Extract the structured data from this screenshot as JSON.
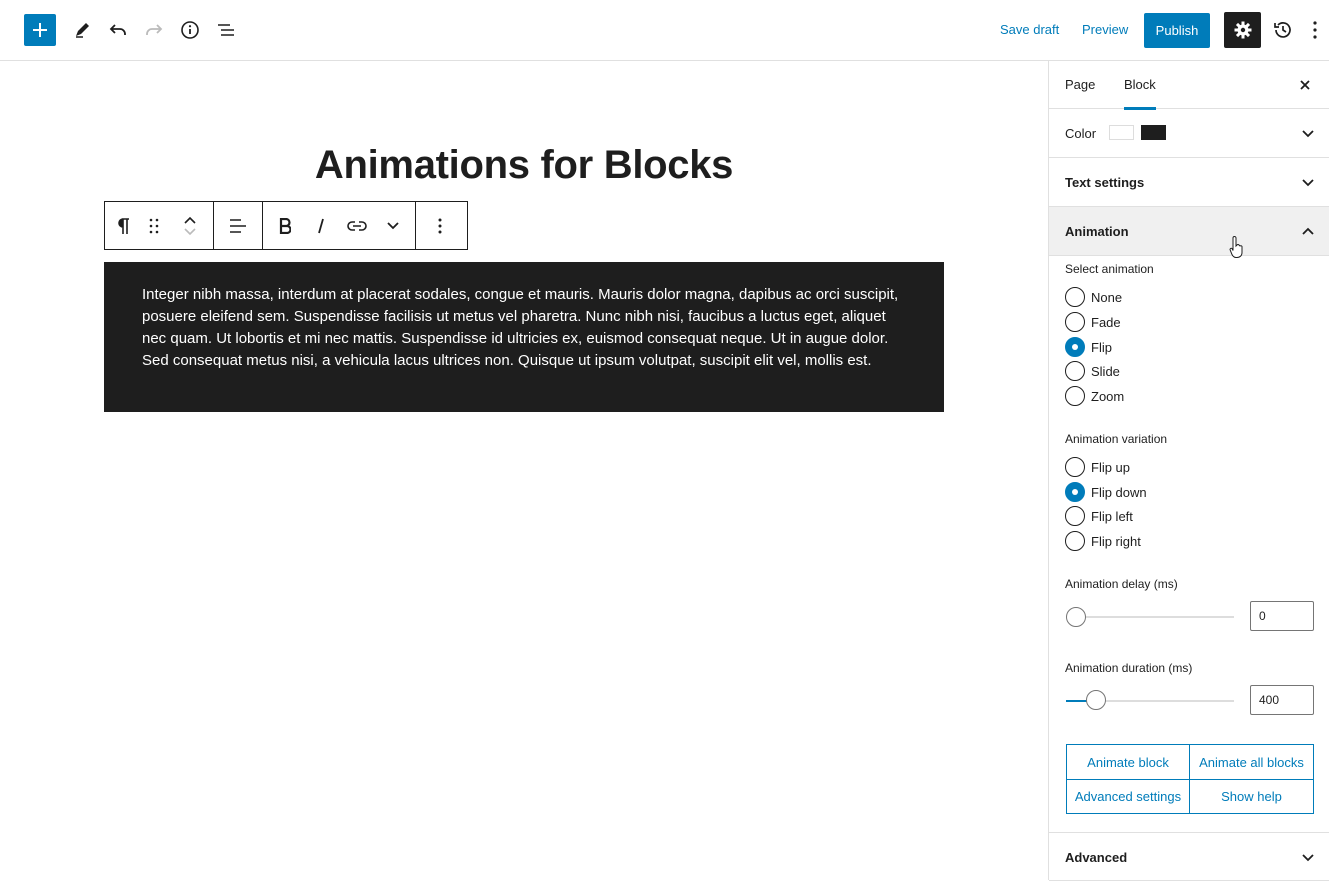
{
  "topbar": {
    "save_draft": "Save draft",
    "preview": "Preview",
    "publish": "Publish"
  },
  "editor": {
    "title": "Animations for Blocks",
    "paragraph": "Integer nibh massa, interdum at placerat sodales, congue et mauris. Mauris dolor magna, dapibus ac orci suscipit, posuere eleifend sem. Suspendisse facilisis ut metus vel pharetra. Nunc nibh nisi, faucibus a luctus eget, aliquet nec quam. Ut lobortis et mi nec mattis. Suspendisse id ultricies ex, euismod consequat neque. Ut in augue dolor. Sed consequat metus nisi, a vehicula lacus ultrices non. Quisque ut ipsum volutpat, suscipit elit vel, mollis est.",
    "paragraph_bg": "#1e1e1e",
    "paragraph_color": "#ffffff"
  },
  "sidebar": {
    "tabs": [
      "Page",
      "Block"
    ],
    "active_tab": "Block",
    "panels": {
      "color": "Color",
      "text_settings": "Text settings",
      "animation": "Animation",
      "advanced": "Advanced"
    },
    "color_swatches": [
      "#ffffff",
      "#1e1e1e"
    ],
    "animation": {
      "select_label": "Select animation",
      "options": [
        "None",
        "Fade",
        "Flip",
        "Slide",
        "Zoom"
      ],
      "selected": "Flip",
      "variation_label": "Animation variation",
      "variations": [
        "Flip up",
        "Flip down",
        "Flip left",
        "Flip right"
      ],
      "selected_variation": "Flip down",
      "delay_label": "Animation delay (ms)",
      "delay_value": "0",
      "duration_label": "Animation duration (ms)",
      "duration_value": "400",
      "buttons": [
        "Animate block",
        "Animate all blocks",
        "Advanced settings",
        "Show help"
      ]
    }
  },
  "colors": {
    "accent": "#007cba",
    "dark": "#1e1e1e"
  }
}
